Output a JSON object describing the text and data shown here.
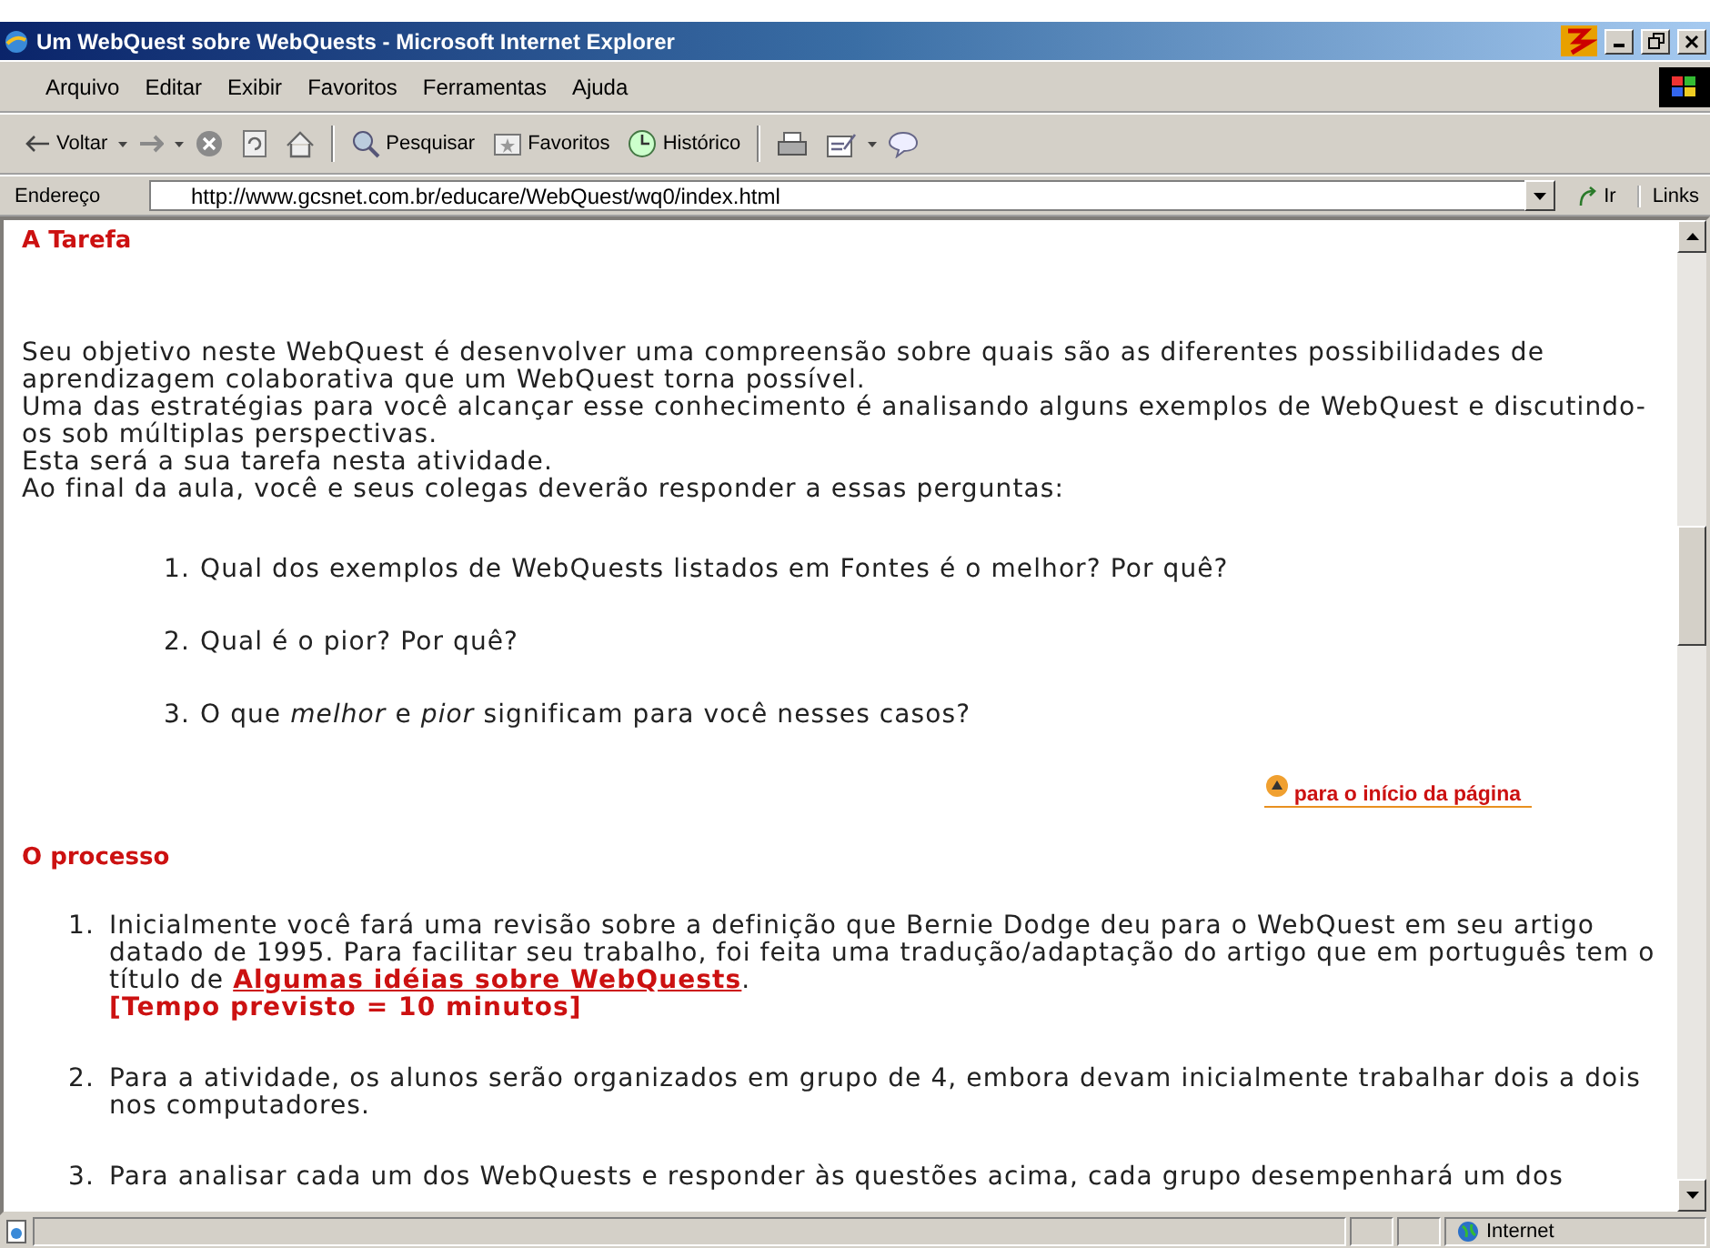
{
  "window": {
    "title": "Um WebQuest sobre WebQuests - Microsoft Internet Explorer"
  },
  "menu": [
    "Arquivo",
    "Editar",
    "Exibir",
    "Favoritos",
    "Ferramentas",
    "Ajuda"
  ],
  "toolbar": [
    {
      "kind": "back",
      "label": "Voltar"
    },
    {
      "kind": "forward"
    },
    {
      "kind": "stop"
    },
    {
      "kind": "refresh"
    },
    {
      "kind": "home"
    },
    {
      "kind": "search",
      "label": "Pesquisar"
    },
    {
      "kind": "favorites",
      "label": "Favoritos"
    },
    {
      "kind": "history",
      "label": "Histórico"
    },
    {
      "kind": "print"
    },
    {
      "kind": "edit"
    },
    {
      "kind": "discuss"
    }
  ],
  "address": {
    "label": "Endereço",
    "value": "http://www.gcsnet.com.br/educare/WebQuest/wq0/index.html",
    "go": "Ir",
    "links": "Links"
  },
  "task": {
    "heading": "A Tarefa",
    "paragraphs": [
      "Seu objetivo neste WebQuest é desenvolver uma compreensão sobre quais são as diferentes possibilidades de aprendizagem colaborativa que um WebQuest torna possível.",
      "Uma das estratégias para você alcançar esse conhecimento é analisando alguns exemplos de WebQuest e discutindo-os sob múltiplas perspectivas.",
      "Esta será a sua tarefa nesta atividade.",
      "Ao final da aula, você e seus colegas deverão responder a essas perguntas:"
    ],
    "questions": [
      {
        "number": "1.",
        "text": "Qual dos exemplos de WebQuests listados em Fontes é o melhor? Por quê?"
      },
      {
        "number": "2.",
        "text": "Qual é o pior? Por quê?"
      },
      {
        "number": "3.",
        "text": "O que *melhor* e *pior* significam para você nesses casos?"
      }
    ],
    "top_link": "para o início da página"
  },
  "process": {
    "heading": "O processo",
    "steps": [
      {
        "number": "1.",
        "text": "Inicialmente você fará uma revisão sobre a definição que Bernie Dodge deu para o WebQuest em seu artigo datado de 1995. Para facilitar seu trabalho, foi feita uma tradução/adaptação do artigo que em português tem o título de ",
        "link": "Algumas idéias sobre WebQuests",
        "after": ".",
        "note": "[Tempo previsto = 10 minutos]"
      },
      {
        "number": "2.",
        "text": "Para a atividade, os alunos serão organizados em grupo de 4, embora devam inicialmente trabalhar dois a dois nos computadores."
      },
      {
        "number": "3.",
        "text": "Para analisar cada um dos WebQuests e responder às questões acima, cada grupo desempenhará um dos"
      }
    ]
  },
  "status_bar": {
    "zone": "Internet"
  }
}
